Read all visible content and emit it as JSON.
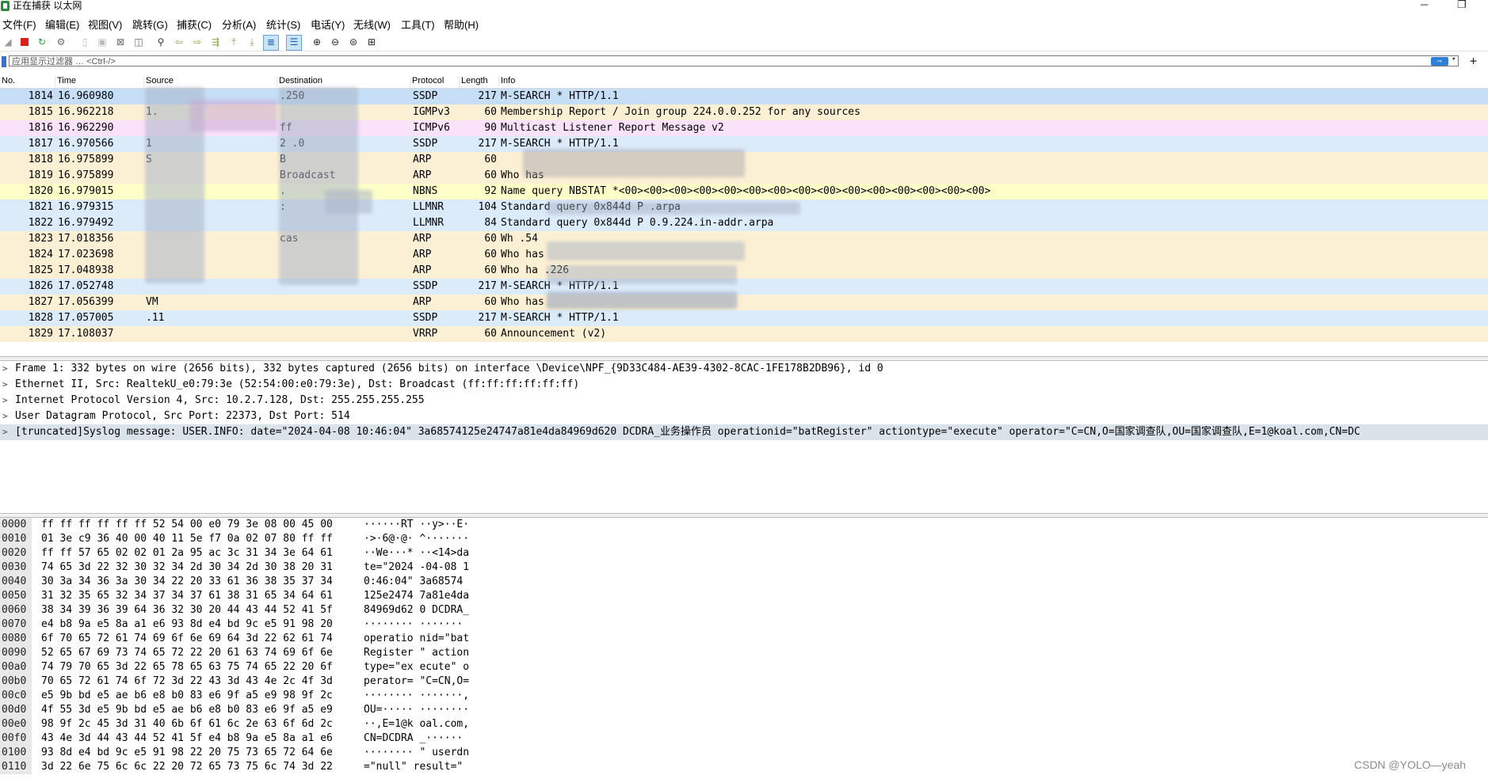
{
  "window": {
    "title": "正在捕获 以太网",
    "minimize_glyph": "─",
    "restore_glyph": "❐"
  },
  "menu": [
    "文件(F)",
    "编辑(E)",
    "视图(V)",
    "跳转(G)",
    "捕获(C)",
    "分析(A)",
    "统计(S)",
    "电话(Y)",
    "无线(W)",
    "工具(T)",
    "帮助(H)"
  ],
  "toolbar_icons": [
    "shark-fin-icon",
    "stop-capture-icon",
    "restart-capture-icon",
    "capture-options-icon",
    "open-file-icon",
    "save-file-icon",
    "close-file-icon",
    "reload-file-icon",
    "find-packet-icon",
    "go-back-icon",
    "go-forward-icon",
    "go-to-packet-icon",
    "go-first-icon",
    "go-last-icon",
    "autoscroll-icon",
    "colorize-icon",
    "zoom-in-icon",
    "zoom-out-icon",
    "zoom-normal-icon",
    "resize-columns-icon"
  ],
  "filter": {
    "placeholder": "应用显示过滤器 … <Ctrl-/>",
    "apply_glyph": "⇨",
    "dropdown_glyph": "▾",
    "add_glyph": "+"
  },
  "packet_list": {
    "columns": [
      "No.",
      "Time",
      "Source",
      "Destination",
      "Protocol",
      "Length",
      "Info"
    ],
    "rows": [
      {
        "no": "1814",
        "time": "16.960980",
        "src": "",
        "dst": "               .250",
        "proto": "SSDP",
        "len": "217",
        "info": "M-SEARCH * HTTP/1.1",
        "bg": "#c6dff7"
      },
      {
        "no": "1815",
        "time": "16.962218",
        "src": "1.",
        "dst": "",
        "proto": "IGMPv3",
        "len": "60",
        "info": "Membership Report / Join group 224.0.0.252 for any sources",
        "bg": "#fcf0d4"
      },
      {
        "no": "1816",
        "time": "16.962290",
        "src": "",
        "dst": "ff",
        "proto": "ICMPv6",
        "len": "90",
        "info": "Multicast Listener Report Message v2",
        "bg": "#fbe2fb"
      },
      {
        "no": "1817",
        "time": "16.970566",
        "src": "1",
        "dst": "2              .0",
        "proto": "SSDP",
        "len": "217",
        "info": "M-SEARCH * HTTP/1.1",
        "bg": "#dcebfa"
      },
      {
        "no": "1818",
        "time": "16.975899",
        "src": "S",
        "dst": "B",
        "proto": "ARP",
        "len": "60",
        "info": "",
        "bg": "#fcf0d4"
      },
      {
        "no": "1819",
        "time": "16.975899",
        "src": "",
        "dst": "Broadcast",
        "proto": "ARP",
        "len": "60",
        "info": "Who has",
        "bg": "#fcf0d4"
      },
      {
        "no": "1820",
        "time": "16.979015",
        "src": "",
        "dst": "       .",
        "proto": "NBNS",
        "len": "92",
        "info": "Name query NBSTAT *<00><00><00><00><00><00><00><00><00><00><00><00><00><00><00>",
        "bg": "#fefec9"
      },
      {
        "no": "1821",
        "time": "16.979315",
        "src": "",
        "dst": "       :",
        "proto": "LLMNR",
        "len": "104",
        "info": "Standard query 0x844d P                    .arpa",
        "bg": "#dcebfa"
      },
      {
        "no": "1822",
        "time": "16.979492",
        "src": "",
        "dst": "",
        "proto": "LLMNR",
        "len": "84",
        "info": "Standard query 0x844d P       0.9.224.in-addr.arpa",
        "bg": "#dcebfa"
      },
      {
        "no": "1823",
        "time": "17.018356",
        "src": "",
        "dst": "       cas",
        "proto": "ARP",
        "len": "60",
        "info": "Wh                       .54",
        "bg": "#fcf0d4"
      },
      {
        "no": "1824",
        "time": "17.023698",
        "src": "",
        "dst": "",
        "proto": "ARP",
        "len": "60",
        "info": "Who has",
        "bg": "#fcf0d4"
      },
      {
        "no": "1825",
        "time": "17.048938",
        "src": "",
        "dst": "",
        "proto": "ARP",
        "len": "60",
        "info": "Who ha                       .226",
        "bg": "#fcf0d4"
      },
      {
        "no": "1826",
        "time": "17.052748",
        "src": "",
        "dst": "",
        "proto": "SSDP",
        "len": "217",
        "info": "M-SEARCH * HTTP/1.1",
        "bg": "#dcebfa"
      },
      {
        "no": "1827",
        "time": "17.056399",
        "src": "VM",
        "dst": "",
        "proto": "ARP",
        "len": "60",
        "info": "Who has",
        "bg": "#fcf0d4"
      },
      {
        "no": "1828",
        "time": "17.057005",
        "src": "      .11",
        "dst": "",
        "proto": "SSDP",
        "len": "217",
        "info": "M-SEARCH * HTTP/1.1",
        "bg": "#dcebfa"
      },
      {
        "no": "1829",
        "time": "17.108037",
        "src": "",
        "dst": "",
        "proto": "VRRP",
        "len": "60",
        "info": "Announcement (v2)",
        "bg": "#fcf0d4"
      }
    ]
  },
  "details": [
    {
      "text": "Frame 1: 332 bytes on wire (2656 bits), 332 bytes captured (2656 bits) on interface \\Device\\NPF_{9D33C484-AE39-4302-8CAC-1FE178B2DB96}, id 0",
      "arrow": ">"
    },
    {
      "text": "Ethernet II, Src: RealtekU_e0:79:3e (52:54:00:e0:79:3e), Dst: Broadcast (ff:ff:ff:ff:ff:ff)",
      "arrow": ">"
    },
    {
      "text": "Internet Protocol Version 4, Src: 10.2.7.128, Dst: 255.255.255.255",
      "arrow": ">"
    },
    {
      "text": "User Datagram Protocol, Src Port: 22373, Dst Port: 514",
      "arrow": ">"
    },
    {
      "text": " [truncated]Syslog message: USER.INFO: date=\"2024-04-08 10:46:04\" 3a68574125e24747a81e4da84969d620 DCDRA_业务操作员 operationid=\"batRegister\" actiontype=\"execute\" operator=\"C=CN,O=国家调查队,OU=国家调查队,E=1@koal.com,CN=DC",
      "arrow": ">"
    }
  ],
  "bytes": [
    {
      "off": "0000",
      "hex": "ff ff ff ff ff ff 52 54  00 e0 79 3e 08 00 45 00",
      "asc": "······RT ··y>··E·"
    },
    {
      "off": "0010",
      "hex": "01 3e c9 36 40 00 40 11  5e f7 0a 02 07 80 ff ff",
      "asc": "·>·6@·@· ^·······"
    },
    {
      "off": "0020",
      "hex": "ff ff 57 65 02 02 01 2a  95 ac 3c 31 34 3e 64 61",
      "asc": "··We···* ··<14>da"
    },
    {
      "off": "0030",
      "hex": "74 65 3d 22 32 30 32 34  2d 30 34 2d 30 38 20 31",
      "asc": "te=\"2024 -04-08 1"
    },
    {
      "off": "0040",
      "hex": "30 3a 34 36 3a 30 34 22  20 33 61 36 38 35 37 34",
      "asc": "0:46:04\"  3a68574"
    },
    {
      "off": "0050",
      "hex": "31 32 35 65 32 34 37 34  37 61 38 31 65 34 64 61",
      "asc": "125e2474 7a81e4da"
    },
    {
      "off": "0060",
      "hex": "38 34 39 36 39 64 36 32  30 20 44 43 44 52 41 5f",
      "asc": "84969d62 0 DCDRA_"
    },
    {
      "off": "0070",
      "hex": "e4 b8 9a e5 8a a1 e6 93  8d e4 bd 9c e5 91 98 20",
      "asc": "········ ······· "
    },
    {
      "off": "0080",
      "hex": "6f 70 65 72 61 74 69 6f  6e 69 64 3d 22 62 61 74",
      "asc": "operatio nid=\"bat"
    },
    {
      "off": "0090",
      "hex": "52 65 67 69 73 74 65 72  22 20 61 63 74 69 6f 6e",
      "asc": "Register \" action"
    },
    {
      "off": "00a0",
      "hex": "74 79 70 65 3d 22 65 78  65 63 75 74 65 22 20 6f",
      "asc": "type=\"ex ecute\" o"
    },
    {
      "off": "00b0",
      "hex": "70 65 72 61 74 6f 72 3d  22 43 3d 43 4e 2c 4f 3d",
      "asc": "perator= \"C=CN,O="
    },
    {
      "off": "00c0",
      "hex": "e5 9b bd e5 ae b6 e8 b0  83 e6 9f a5 e9 98 9f 2c",
      "asc": "········ ·······,"
    },
    {
      "off": "00d0",
      "hex": "4f 55 3d e5 9b bd e5 ae  b6 e8 b0 83 e6 9f a5 e9",
      "asc": "OU=····· ········"
    },
    {
      "off": "00e0",
      "hex": "98 9f 2c 45 3d 31 40 6b  6f 61 6c 2e 63 6f 6d 2c",
      "asc": "··,E=1@k oal.com,"
    },
    {
      "off": "00f0",
      "hex": "43 4e 3d 44 43 44 52 41  5f e4 b8 9a e5 8a a1 e6",
      "asc": "CN=DCDRA _······"
    },
    {
      "off": "0100",
      "hex": "93 8d e4 bd 9c e5 91 98  22 20 75 73 65 72 64 6e",
      "asc": "········ \" userdn"
    },
    {
      "off": "0110",
      "hex": "3d 22 6e 75 6c 6c 22 20  72 65 73 75 6c 74 3d 22",
      "asc": "=\"null\"  result=\""
    }
  ],
  "watermark": "CSDN @YOLO—yeah"
}
